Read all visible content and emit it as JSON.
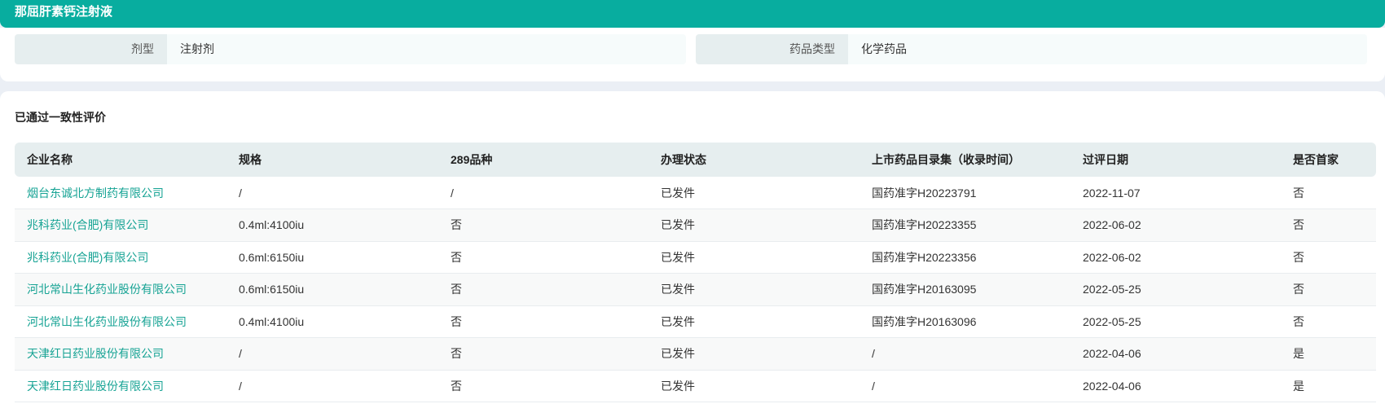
{
  "title": "那屈肝素钙注射液",
  "info": [
    {
      "label": "剂型",
      "value": "注射剂"
    },
    {
      "label": "药品类型",
      "value": "化学药品"
    }
  ],
  "section_title": "已通过一致性评价",
  "table": {
    "headers": [
      "企业名称",
      "规格",
      "289品种",
      "办理状态",
      "上市药品目录集（收录时间）",
      "过评日期",
      "是否首家"
    ],
    "rows": [
      [
        "烟台东诚北方制药有限公司",
        "/",
        "/",
        "已发件",
        "国药准字H20223791",
        "2022-11-07",
        "否"
      ],
      [
        "兆科药业(合肥)有限公司",
        "0.4ml:4100iu",
        "否",
        "已发件",
        "国药准字H20223355",
        "2022-06-02",
        "否"
      ],
      [
        "兆科药业(合肥)有限公司",
        "0.6ml:6150iu",
        "否",
        "已发件",
        "国药准字H20223356",
        "2022-06-02",
        "否"
      ],
      [
        "河北常山生化药业股份有限公司",
        "0.6ml:6150iu",
        "否",
        "已发件",
        "国药准字H20163095",
        "2022-05-25",
        "否"
      ],
      [
        "河北常山生化药业股份有限公司",
        "0.4ml:4100iu",
        "否",
        "已发件",
        "国药准字H20163096",
        "2022-05-25",
        "否"
      ],
      [
        "天津红日药业股份有限公司",
        "/",
        "否",
        "已发件",
        "/",
        "2022-04-06",
        "是"
      ],
      [
        "天津红日药业股份有限公司",
        "/",
        "否",
        "已发件",
        "/",
        "2022-04-06",
        "是"
      ]
    ]
  }
}
